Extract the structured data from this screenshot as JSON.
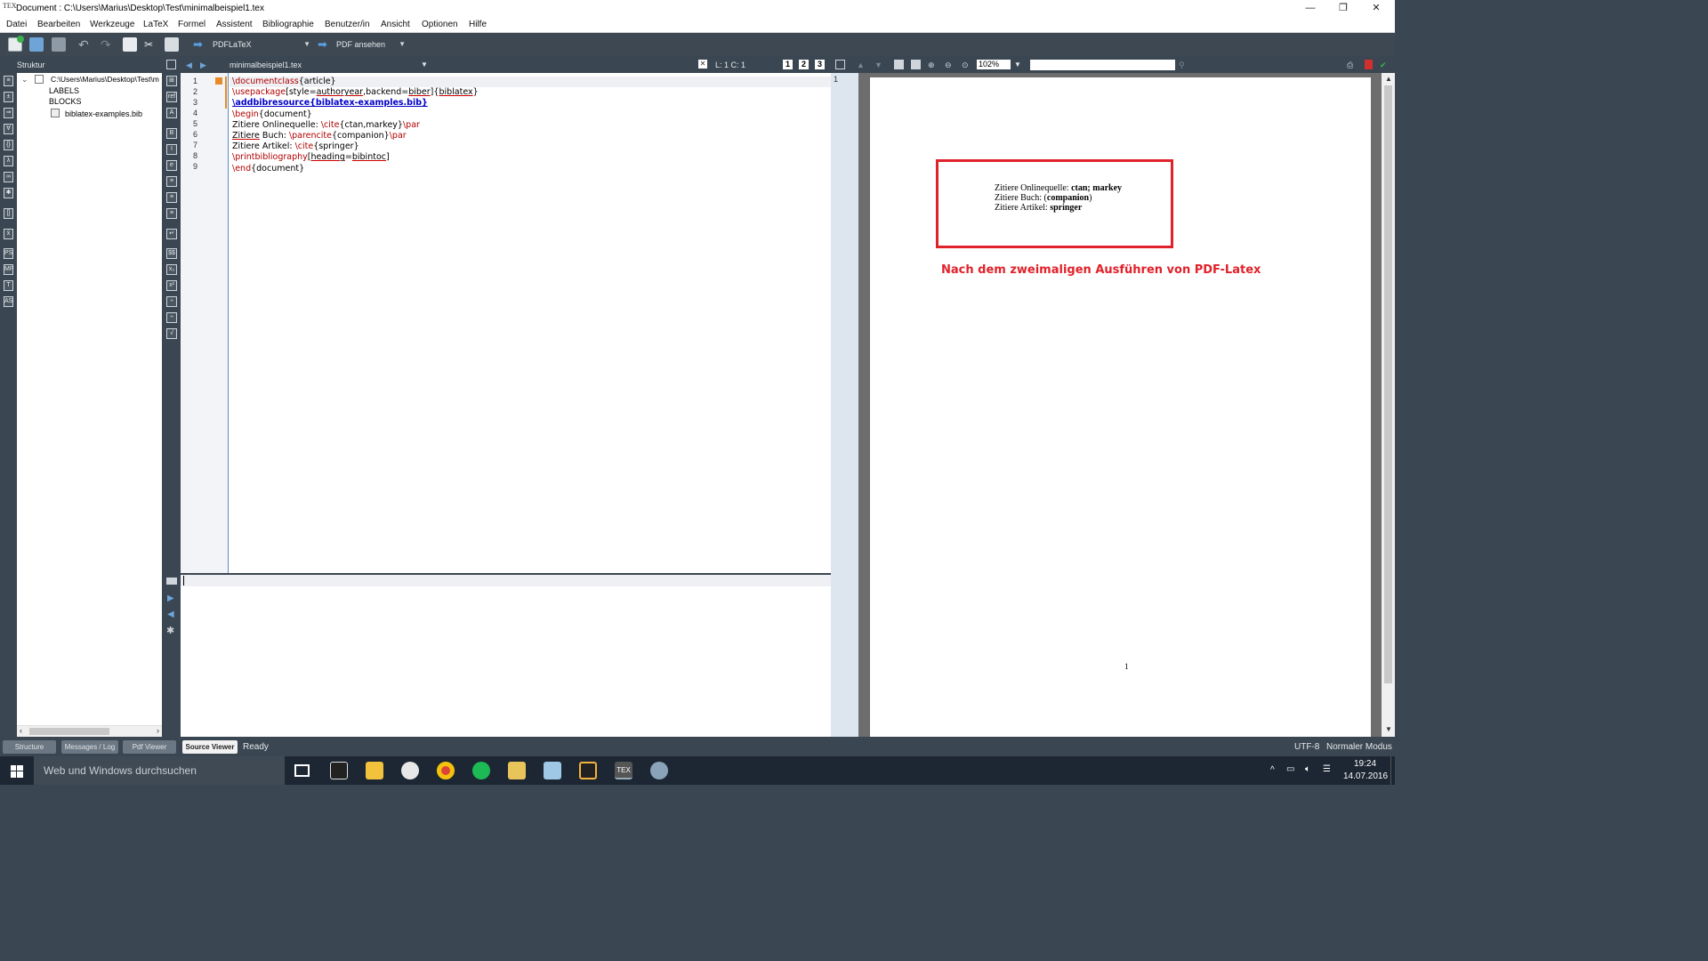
{
  "window": {
    "title": "Document : C:\\Users\\Marius\\Desktop\\Test\\minimalbeispiel1.tex",
    "app_icon_text": "TEX",
    "controls": {
      "minimize": "—",
      "restore": "❐",
      "close": "✕"
    }
  },
  "menu": [
    "Datei",
    "Bearbeiten",
    "Werkzeuge",
    "LaTeX",
    "Formel",
    "Assistent",
    "Bibliographie",
    "Benutzer/in",
    "Ansicht",
    "Optionen",
    "Hilfe"
  ],
  "toolbar": {
    "compile_tool": "PDFLaTeX",
    "view_tool": "PDF ansehen"
  },
  "structure": {
    "title": "Struktur",
    "root": "C:\\Users\\Marius\\Desktop\\Test\\m",
    "items": [
      "LABELS",
      "BLOCKS",
      "biblatex-examples.bib"
    ]
  },
  "editor": {
    "filename": "minimalbeispiel1.tex",
    "position": "L: 1 C: 1",
    "view_buttons": [
      "1",
      "2",
      "3"
    ],
    "lines": [
      {
        "n": "1",
        "parts": [
          [
            "cmd",
            "\\documentclass"
          ],
          [
            "",
            "{article}"
          ]
        ]
      },
      {
        "n": "2",
        "parts": [
          [
            "cmd",
            "\\usepackage"
          ],
          [
            "",
            "[style="
          ],
          [
            "ul",
            "authoryear"
          ],
          [
            "",
            ",backend="
          ],
          [
            "ul",
            "biber"
          ],
          [
            "",
            "]{"
          ],
          [
            "ul",
            "biblatex"
          ],
          [
            "",
            "}"
          ]
        ]
      },
      {
        "n": "3",
        "parts": [
          [
            "kw",
            "\\addbibresource{biblatex-examples.bib}"
          ]
        ]
      },
      {
        "n": "4",
        "parts": [
          [
            "cmd",
            "\\begin"
          ],
          [
            "",
            "{document}"
          ]
        ]
      },
      {
        "n": "5",
        "parts": [
          [
            "",
            "Zitiere Onlinequelle: "
          ],
          [
            "cmd",
            "\\cite"
          ],
          [
            "",
            "{ctan,markey}"
          ],
          [
            "cmd",
            "\\par"
          ]
        ]
      },
      {
        "n": "6",
        "parts": [
          [
            "ul",
            "Zitiere"
          ],
          [
            "",
            " Buch: "
          ],
          [
            "cmd",
            "\\parencite"
          ],
          [
            "",
            "{companion}"
          ],
          [
            "cmd",
            "\\par"
          ]
        ]
      },
      {
        "n": "7",
        "parts": [
          [
            "",
            "Zitiere Artikel: "
          ],
          [
            "cmd",
            "\\cite"
          ],
          [
            "",
            "{springer}"
          ]
        ]
      },
      {
        "n": "8",
        "parts": [
          [
            "cmd",
            "\\printbibliography"
          ],
          [
            "",
            "["
          ],
          [
            "ul",
            "heading"
          ],
          [
            "",
            "="
          ],
          [
            "ul",
            "bibintoc"
          ],
          [
            "",
            "]"
          ]
        ]
      },
      {
        "n": "9",
        "parts": [
          [
            "cmd",
            "\\end"
          ],
          [
            "",
            "{document}"
          ]
        ]
      }
    ]
  },
  "pdf": {
    "zoom": "102%",
    "page_marker": "1",
    "page_number": "1",
    "output_lines": [
      {
        "label": "Zitiere Onlinequelle: ",
        "value": "ctan; markey"
      },
      {
        "label": "Zitiere Buch: (",
        "value": "companion",
        "suffix": ")"
      },
      {
        "label": "Zitiere Artikel: ",
        "value": "springer"
      }
    ],
    "annotation": "Nach dem zweimaligen Ausführen von PDF-Latex",
    "annotation_color": "#e0222a"
  },
  "statusbar": {
    "tabs": [
      "Structure",
      "Messages / Log",
      "Pdf Viewer",
      "Source Viewer"
    ],
    "active_tab": "Source Viewer",
    "status": "Ready",
    "encoding": "UTF-8",
    "mode": "Normaler Modus"
  },
  "taskbar": {
    "search_placeholder": "Web und Windows durchsuchen",
    "time": "19:24",
    "date": "14.07.2016"
  }
}
